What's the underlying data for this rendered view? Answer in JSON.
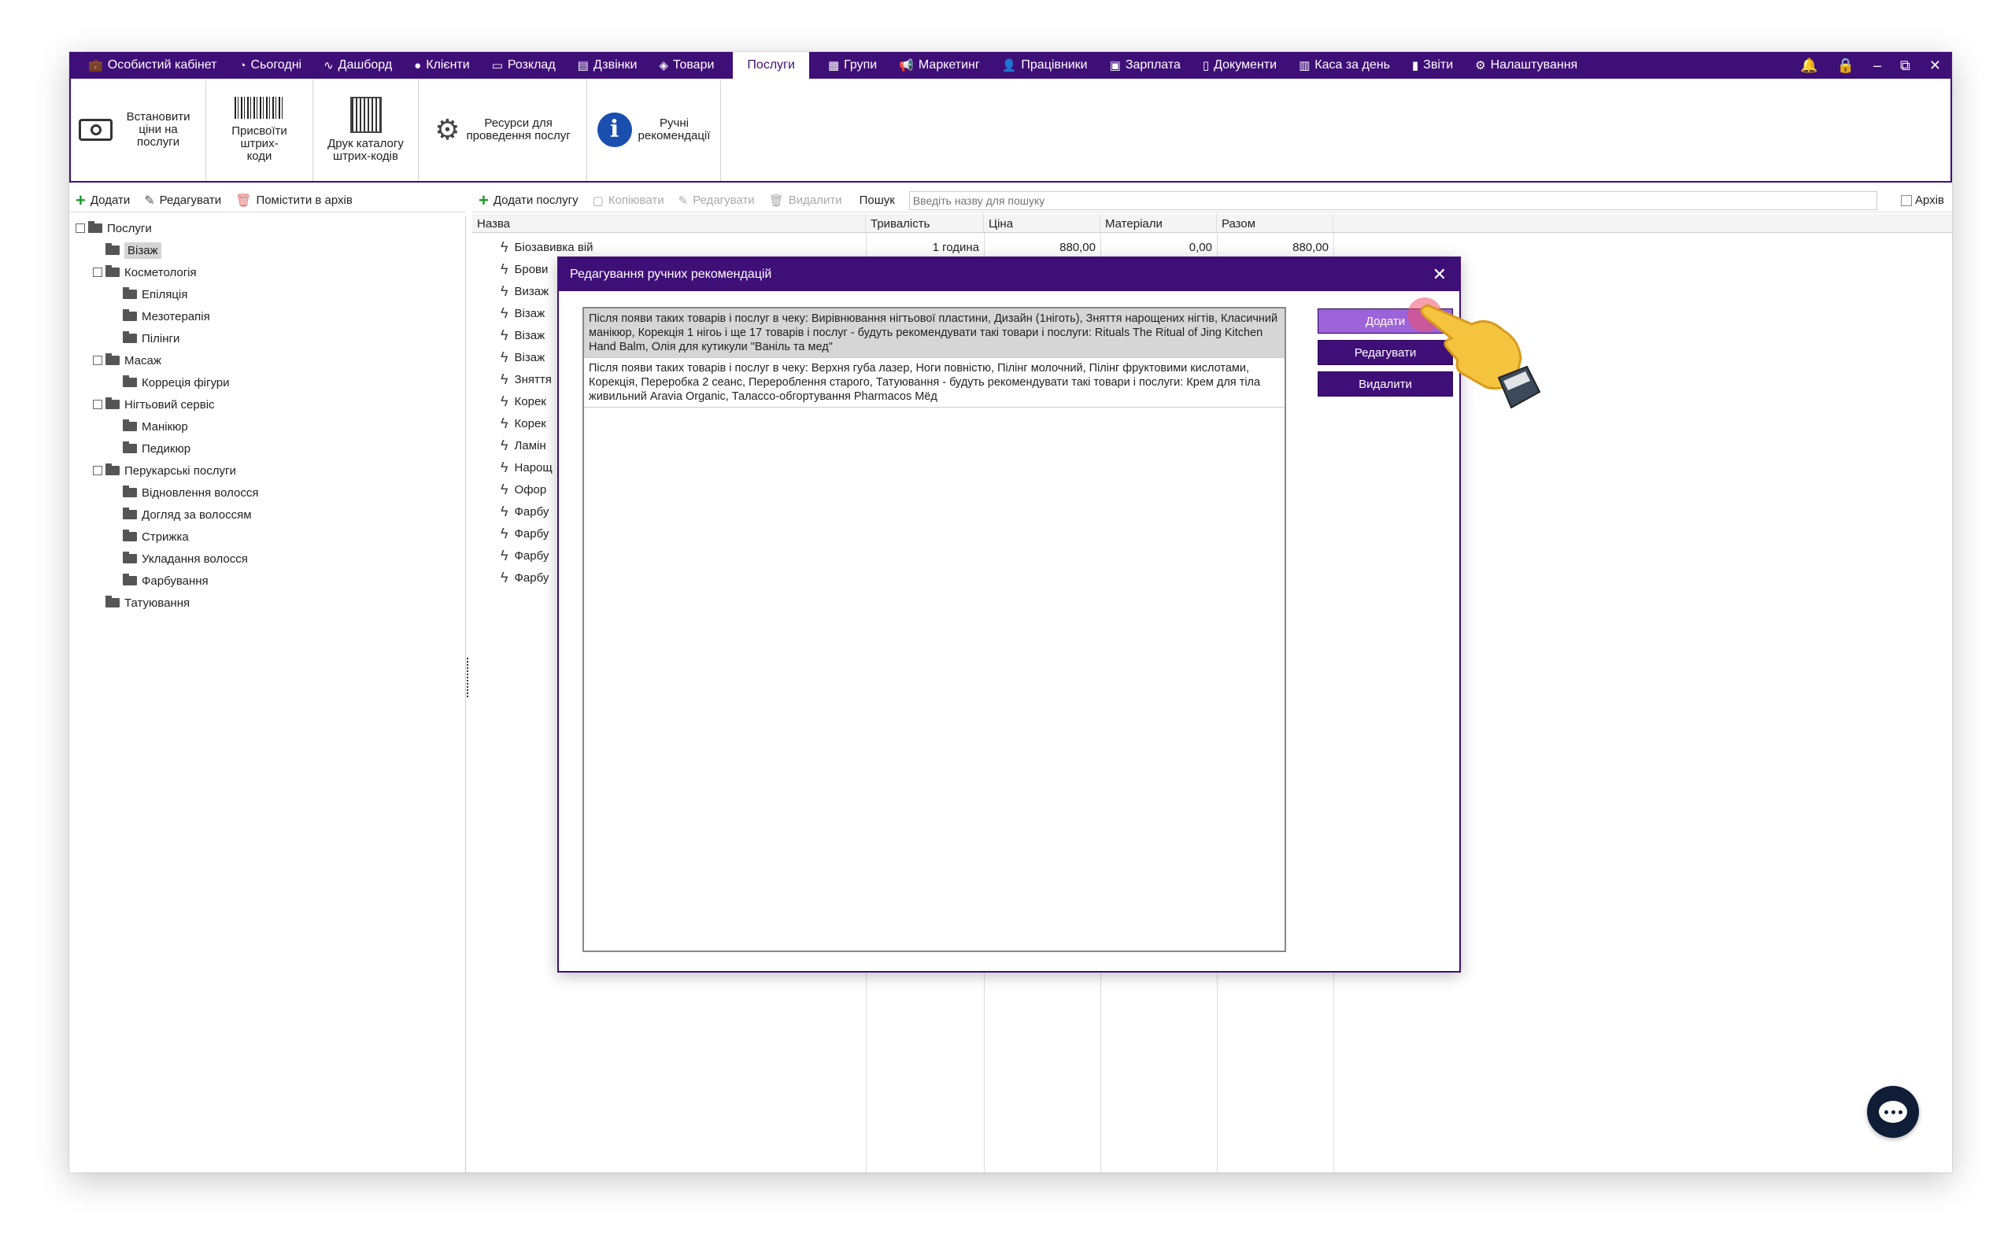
{
  "menu": {
    "items": [
      {
        "icon": "briefcase-icon",
        "glyph": "💼",
        "label": "Особистий кабінет"
      },
      {
        "icon": "clock-icon",
        "glyph": "◔",
        "label": "Сьогодні"
      },
      {
        "icon": "pulse-icon",
        "glyph": "∿",
        "label": "Дашборд"
      },
      {
        "icon": "user-circle-icon",
        "glyph": "●",
        "label": "Клієнти"
      },
      {
        "icon": "calendar-icon",
        "glyph": "▭",
        "label": "Розклад"
      },
      {
        "icon": "phone-list-icon",
        "glyph": "▤",
        "label": "Дзвінки"
      },
      {
        "icon": "box-icon",
        "glyph": "◈",
        "label": "Товари"
      },
      {
        "icon": "",
        "glyph": "",
        "label": "Послуги"
      },
      {
        "icon": "groups-icon",
        "glyph": "▦",
        "label": "Групи"
      },
      {
        "icon": "megaphone-icon",
        "glyph": "📢",
        "label": "Маркетинг"
      },
      {
        "icon": "person-icon",
        "glyph": "👤",
        "label": "Працівники"
      },
      {
        "icon": "money-icon",
        "glyph": "▣",
        "label": "Зарплата"
      },
      {
        "icon": "document-icon",
        "glyph": "▯",
        "label": "Документи"
      },
      {
        "icon": "calculator-icon",
        "glyph": "▥",
        "label": "Каса за день"
      },
      {
        "icon": "bar-chart-icon",
        "glyph": "▮",
        "label": "Звіти"
      },
      {
        "icon": "gear-icon",
        "glyph": "⚙",
        "label": "Налаштування"
      }
    ],
    "active": "Послуги"
  },
  "ribbon": {
    "set_prices": {
      "line1": "Встановити",
      "line2": "ціни на послуги"
    },
    "assign_barcodes": {
      "line1": "Присвоїти штрих-",
      "line2": "коди"
    },
    "print_catalog": {
      "line1": "Друк каталогу",
      "line2": "штрих-кодів"
    },
    "resources": {
      "line1": "Ресурси для",
      "line2": "проведення послуг"
    },
    "manual_recs": {
      "line1": "Ручні",
      "line2": "рекомендації"
    }
  },
  "left_toolbar": {
    "add": "Додати",
    "edit": "Редагувати",
    "archive": "Помістити в архів"
  },
  "tree": [
    {
      "label": "Послуги",
      "level": 0,
      "expander": true
    },
    {
      "label": "Візаж",
      "level": 1,
      "selected": true
    },
    {
      "label": "Косметологія",
      "level": 1,
      "expander": true
    },
    {
      "label": "Епіляція",
      "level": 2
    },
    {
      "label": "Мезотерапія",
      "level": 2
    },
    {
      "label": "Пілінги",
      "level": 2
    },
    {
      "label": "Масаж",
      "level": 1,
      "expander": true
    },
    {
      "label": "Корреція фігури",
      "level": 2
    },
    {
      "label": "Нігтьовий сервіс",
      "level": 1,
      "expander": true
    },
    {
      "label": "Манікюр",
      "level": 2
    },
    {
      "label": "Педикюр",
      "level": 2
    },
    {
      "label": "Перукарські послуги",
      "level": 1,
      "expander": true
    },
    {
      "label": "Відновлення волосся",
      "level": 2
    },
    {
      "label": "Догляд за волоссям",
      "level": 2
    },
    {
      "label": "Стрижка",
      "level": 2
    },
    {
      "label": "Укладання волосся",
      "level": 2
    },
    {
      "label": "Фарбування",
      "level": 2
    },
    {
      "label": "Татуювання",
      "level": 1
    }
  ],
  "right_toolbar": {
    "add_service": "Додати послугу",
    "copy": "Копіювати",
    "edit": "Редагувати",
    "delete": "Видалити",
    "search_label": "Пошук",
    "search_placeholder": "Введіть назву для пошуку",
    "archive": "Архів"
  },
  "grid": {
    "headers": {
      "name": "Назва",
      "duration": "Тривалість",
      "price": "Ціна",
      "materials": "Матеріали",
      "total": "Разом"
    },
    "rows": [
      {
        "name": "Біозавивка вій",
        "duration": "1 година",
        "price": "880,00",
        "materials": "0,00",
        "total": "880,00"
      },
      {
        "name": "Брови",
        "duration": "",
        "price": "",
        "materials": "",
        "total": ""
      },
      {
        "name": "Визаж",
        "duration": "",
        "price": "",
        "materials": "",
        "total": ""
      },
      {
        "name": "Візаж",
        "duration": "",
        "price": "",
        "materials": "",
        "total": ""
      },
      {
        "name": "Візаж",
        "duration": "",
        "price": "",
        "materials": "",
        "total": ""
      },
      {
        "name": "Візаж",
        "duration": "",
        "price": "",
        "materials": "",
        "total": ""
      },
      {
        "name": "Зняття",
        "duration": "",
        "price": "",
        "materials": "",
        "total": ""
      },
      {
        "name": "Корек",
        "duration": "",
        "price": "",
        "materials": "",
        "total": ""
      },
      {
        "name": "Корек",
        "duration": "",
        "price": "",
        "materials": "",
        "total": ""
      },
      {
        "name": "Ламін",
        "duration": "",
        "price": "",
        "materials": "",
        "total": ""
      },
      {
        "name": "Нарощ",
        "duration": "",
        "price": "",
        "materials": "",
        "total": ""
      },
      {
        "name": "Офор",
        "duration": "",
        "price": "",
        "materials": "",
        "total": ""
      },
      {
        "name": "Фарбу",
        "duration": "",
        "price": "",
        "materials": "",
        "total": ""
      },
      {
        "name": "Фарбу",
        "duration": "",
        "price": "",
        "materials": "",
        "total": ""
      },
      {
        "name": "Фарбу",
        "duration": "",
        "price": "",
        "materials": "",
        "total": ""
      },
      {
        "name": "Фарбу",
        "duration": "",
        "price": "",
        "materials": "",
        "total": ""
      }
    ]
  },
  "modal": {
    "title": "Редагування ручних рекомендацій",
    "close": "✕",
    "recommendations": [
      "Після появи таких товарів і послуг в чеку: Вирівнювання нігтьової пластини, Дизайн (1ніготь), Зняття нарощених нігтів, Класичний манікюр, Корекція 1 нігоь і ще 17 товарів і послуг - будуть рекомендувати такі товари і послуги: Rituals The Ritual of Jing Kitchen Hand Balm, Олія для кутикули \"Ваніль та мед\"",
      "Після появи таких товарів і послуг в чеку: Верхня губа лазер, Ноги повністю, Пілінг молочний, Пілінг фруктовими кислотами, Корекція, Переробка 2 сеанс, Перероблення старого, Татуювання - будуть рекомендувати такі товари і послуги: Крем для тіла живильний Aravia Organic, Талассо-обгортування Pharmacos Мёд"
    ],
    "buttons": {
      "add": "Додати",
      "edit": "Редагувати",
      "delete": "Видалити"
    }
  },
  "window_controls": {
    "bell": "🔔",
    "lock": "🔒",
    "minimize": "–",
    "restore": "⧉",
    "close": "✕"
  },
  "colors": {
    "brand": "#3f0f78",
    "hover_button": "#9d63d8",
    "chat": "#0f1d36"
  }
}
